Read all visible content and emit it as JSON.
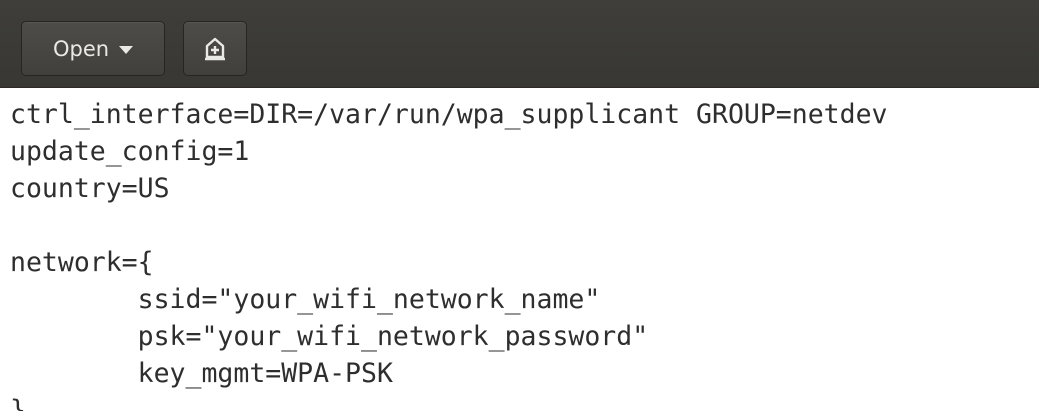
{
  "toolbar": {
    "open_label": "Open",
    "open_caret_icon": "triangle-down-icon",
    "new_document_icon": "document-new-icon"
  },
  "editor": {
    "lines": [
      "ctrl_interface=DIR=/var/run/wpa_supplicant GROUP=netdev",
      "update_config=1",
      "country=US",
      "",
      "network={",
      "        ssid=\"your_wifi_network_name\"",
      "        psk=\"your_wifi_network_password\"",
      "        key_mgmt=WPA-PSK",
      "}"
    ]
  },
  "colors": {
    "toolbar_bg": "#3c3b37",
    "button_bg": "#474642",
    "text": "#2e2e2e",
    "editor_bg": "#ffffff"
  }
}
